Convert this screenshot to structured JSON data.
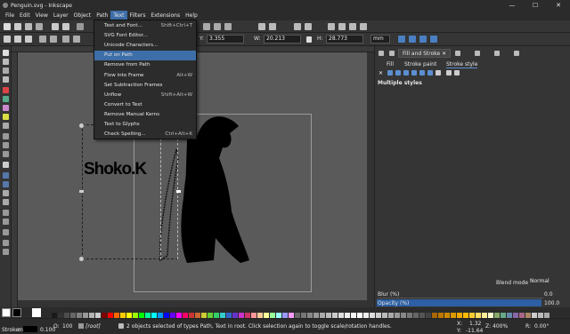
{
  "window": {
    "title": "Penguin.svg - Inkscape",
    "minimize": "—",
    "maximize": "☐",
    "close": "✕"
  },
  "menubar": [
    "File",
    "Edit",
    "View",
    "Layer",
    "Object",
    "Path",
    "Text",
    "Filters",
    "Extensions",
    "Help"
  ],
  "text_menu": {
    "items": [
      {
        "label": "Text and Font...",
        "shortcut": "Shift+Ctrl+T"
      },
      {
        "label": "SVG Font Editor...",
        "shortcut": ""
      },
      {
        "label": "Unicode Characters...",
        "shortcut": ""
      },
      {
        "label": "Put on Path",
        "shortcut": ""
      },
      {
        "label": "Remove from Path",
        "shortcut": ""
      },
      {
        "label": "Flow into Frame",
        "shortcut": "Alt+W"
      },
      {
        "label": "Set Subtraction Frames",
        "shortcut": ""
      },
      {
        "label": "Unflow",
        "shortcut": "Shift+Alt+W"
      },
      {
        "label": "Convert to Text",
        "shortcut": ""
      },
      {
        "label": "Remove Manual Kerns",
        "shortcut": ""
      },
      {
        "label": "Text to Glyphs",
        "shortcut": ""
      },
      {
        "label": "Check Spelling...",
        "shortcut": "Ctrl+Alt+K"
      }
    ]
  },
  "tool_controls": {
    "y_label": "Y:",
    "y_value": "3.355",
    "w_label": "W:",
    "w_value": "20.213",
    "h_label": "H:",
    "h_value": "28.773",
    "unit": "mm"
  },
  "canvas": {
    "text_object": "Shoko.K"
  },
  "right_panel": {
    "tabs": [
      "Fill and Stroke",
      "✕"
    ],
    "subtabs": [
      "Fill",
      "Stroke paint",
      "Stroke style"
    ],
    "heading": "Multiple styles",
    "blend_label": "Blend mode:",
    "blend_value": "Normal",
    "blur_label": "Blur (%)",
    "blur_value": "0.0",
    "opacity_label": "Opacity (%)",
    "opacity_value": "100.0"
  },
  "status": {
    "layer": "[root]",
    "message": "2 objects selected of types Path, Text in root. Click selection again to toggle scale/rotation handles.",
    "stroke_label": "Stroke:",
    "stroke_value": "m",
    "stroke_width": "0.100",
    "opacity_label": "O:",
    "opacity_value": "100",
    "x_label": "X:",
    "x_value": "1.32",
    "y_label": "Y:",
    "y_value": "-11.64",
    "zoom_label": "Z:",
    "zoom_value": "400%",
    "rot_label": "R:",
    "rot_value": "0.00°"
  },
  "colors": {
    "accent": "#3d6ea8",
    "menu_bg": "#2c2c2c",
    "canvas": "#5a5a5a",
    "panel": "#353535"
  }
}
